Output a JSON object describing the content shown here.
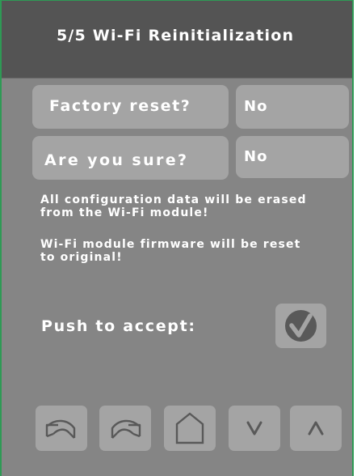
{
  "header": {
    "title": "5/5 Wi-Fi Reinitialization"
  },
  "settings": [
    {
      "label": "Factory reset?",
      "value": "No"
    },
    {
      "label": "Are you sure?",
      "value": "No"
    }
  ],
  "messages": {
    "erase_warning": [
      "All configuration data will be erased",
      "from the Wi-Fi module!"
    ],
    "firmware_warning": [
      "Wi-Fi module firmware will be reset",
      "to original!"
    ]
  },
  "accept": {
    "label": "Push to accept:",
    "icon": "checkmark-icon"
  },
  "nav": [
    {
      "name": "back",
      "icon": "undo-arrow-icon"
    },
    {
      "name": "forward",
      "icon": "redo-arrow-icon"
    },
    {
      "name": "home",
      "icon": "home-icon"
    },
    {
      "name": "down",
      "icon": "chevron-down-icon"
    },
    {
      "name": "up",
      "icon": "chevron-up-icon"
    }
  ],
  "colors": {
    "background": "#858585",
    "title_bar": "#545454",
    "button": "#a4a4a4",
    "icon": "#595959",
    "text": "#ffffff",
    "frame_border": "#2e9a55"
  }
}
